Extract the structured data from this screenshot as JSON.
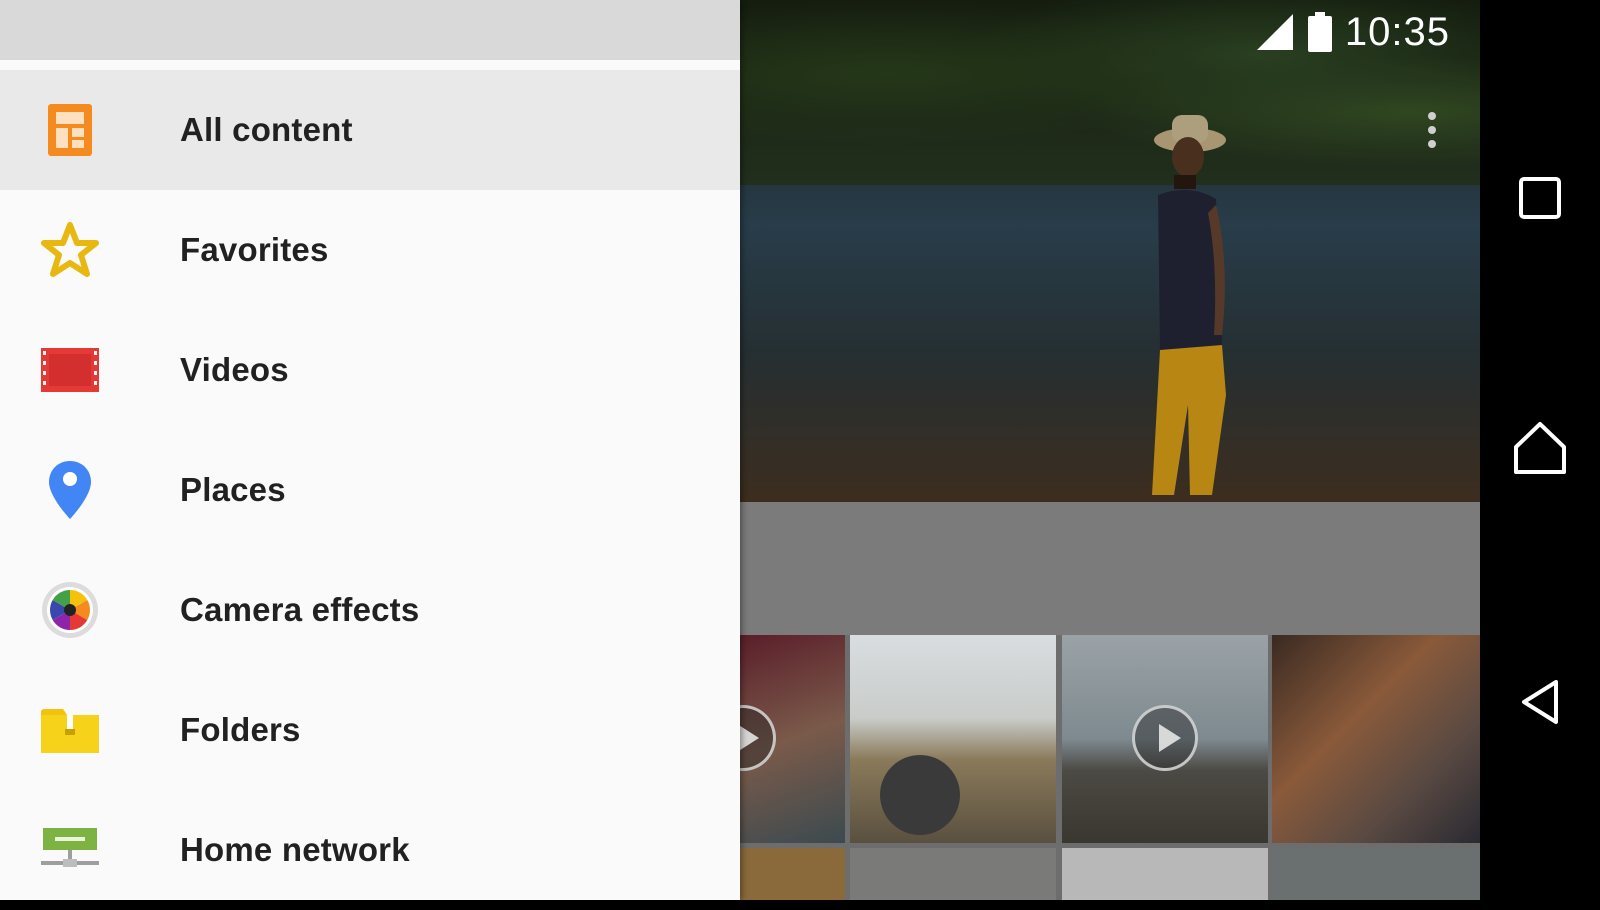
{
  "status_bar": {
    "time": "10:35",
    "icons": [
      "signal-icon",
      "battery-icon"
    ]
  },
  "drawer": {
    "items": [
      {
        "label": "All content",
        "icon": "all-content-icon",
        "selected": true
      },
      {
        "label": "Favorites",
        "icon": "star-icon",
        "selected": false
      },
      {
        "label": "Videos",
        "icon": "film-strip-icon",
        "selected": false
      },
      {
        "label": "Places",
        "icon": "location-pin-icon",
        "selected": false
      },
      {
        "label": "Camera effects",
        "icon": "camera-effects-icon",
        "selected": false
      },
      {
        "label": "Folders",
        "icon": "folder-icon",
        "selected": false
      },
      {
        "label": "Home network",
        "icon": "home-network-icon",
        "selected": false
      }
    ]
  },
  "nav_bar": {
    "buttons": [
      "recents-button",
      "home-button",
      "back-button"
    ]
  },
  "colors": {
    "drawer_bg": "#fafafa",
    "selected_bg": "#e9e9e9",
    "header_bg": "#d9d9d9",
    "accent_orange": "#f58b1f"
  }
}
